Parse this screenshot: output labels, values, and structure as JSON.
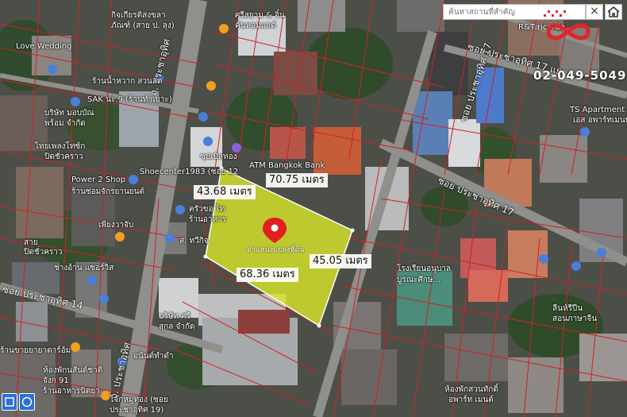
{
  "search": {
    "placeholder": "ค้นหาสถานที่สำคัญ",
    "close": "×"
  },
  "brand": {
    "phone": "02-049-5049"
  },
  "plot": {
    "caption": "ตำแหน่งแปลงที่ดิน",
    "sides": {
      "top": "70.75 เมตร",
      "left": "43.68 เมตร",
      "bottom": "68.36 เมตร",
      "right": "45.05 เมตร"
    }
  },
  "streets": {
    "prachauthit_main": "ถ. ประชาอุทิศ",
    "prachauthit_main_2": "ถ. ประชาอุทิศ",
    "soi17_a": "ซอย ประชาอุทิศ 17 แยก",
    "soi17_b": "ซอย ประชาอุทิศ 17",
    "soi17_c": "ซอย ประชาอุทิศ 17",
    "soi14": "ซอย ประชาอุทิศ 14"
  },
  "places": {
    "kittiphanas": "กิจเกียรติสงขลา",
    "kittiphanas2": "ภัณฑ์ (สาย ป. ลุง)",
    "sreesom": "ศรีสยาม & จิ๋น",
    "sreesom2": "ค้นหอมแลด์",
    "love_wedding": "Love Wedding",
    "nam_pra": "ร้านน้ำหวาก สวนลด",
    "sak_nam9": "SAK นะ.9 (ร้านทำเบาะ)",
    "bangkok_bank": "ATM Bangkok Bank",
    "shoecenter": "Shoecenter1983 (ซอย 12",
    "power2shop": "Power 2 Shop",
    "power2shop_sub": "ร้านซ่อมจักรยานยนต์",
    "company_top": "บริษัท มอบบัณ",
    "company_top2": "พร้อม จำกัด",
    "thai_phle": "ไทยเพลงโทซ์ก",
    "thai_phle2": "ปิดชั่วคราว",
    "sup_ut": "ซุปเบิลทอง",
    "kitchen": "ครัวขอ ไท",
    "kitchen2": "ร้านอาหาร",
    "sw_prachut": "ส. ทวีกิจ",
    "phiang_prachao": "เพียงวาจับ",
    "sai": "สาย",
    "sai2": "ปิดชั่วคราว",
    "chang_an": "ช่างอ้าน แซอร์วิส",
    "ret_ricardo": "R&T ricardo",
    "ts_apartment": "TS Apartment (ทีเอส",
    "ts_apartment2": "เอส อพาร์ทเมนท์)",
    "school": "โรงเรียนอนุบาล",
    "school2": "บูรณะศึกษ...",
    "company_srisuk": "บริษัท ศรี",
    "company_srisuk2": "สุกล จำกัด",
    "anan": "อนันต์ทำดำ",
    "sai_prachin": "ลีนห์รีปีน",
    "sai_prachin2": "สอนภาษาจีน",
    "hanin": "หัวงหนาชมด์",
    "hanin2": "ร้านอาหาร",
    "pharmacy_bottom": "ร้านขายยายาดาร์อ้ม",
    "hongkaew": "ห้องพักนสันต์ชาติ",
    "hongkaew2": "จังก 91",
    "hongkaew3": "ร้านอาหารนิตยา",
    "chia": "โจ๊กหมูทอง (ซอย",
    "chia2": "ประชาอุทิศ 19)",
    "bottom_right": "ห้องพักสวนทักดิ์",
    "bottom_right2": "อพาร์ท เมนต์",
    "krungthai": "ศรีอยู่ทอง"
  },
  "icons": {
    "logo": "logo-icon",
    "home": "home-icon",
    "pin": "location-pin-icon",
    "square_tool": "square-tool-icon",
    "circle_tool": "circle-tool-icon",
    "poi": "poi-icon"
  },
  "colors": {
    "plot_fill": "#d8e32a",
    "plot_stroke": "#ffffff",
    "pin": "#e02020",
    "parcel_line": "#d22020",
    "button_blue": "#2c6fd6"
  }
}
